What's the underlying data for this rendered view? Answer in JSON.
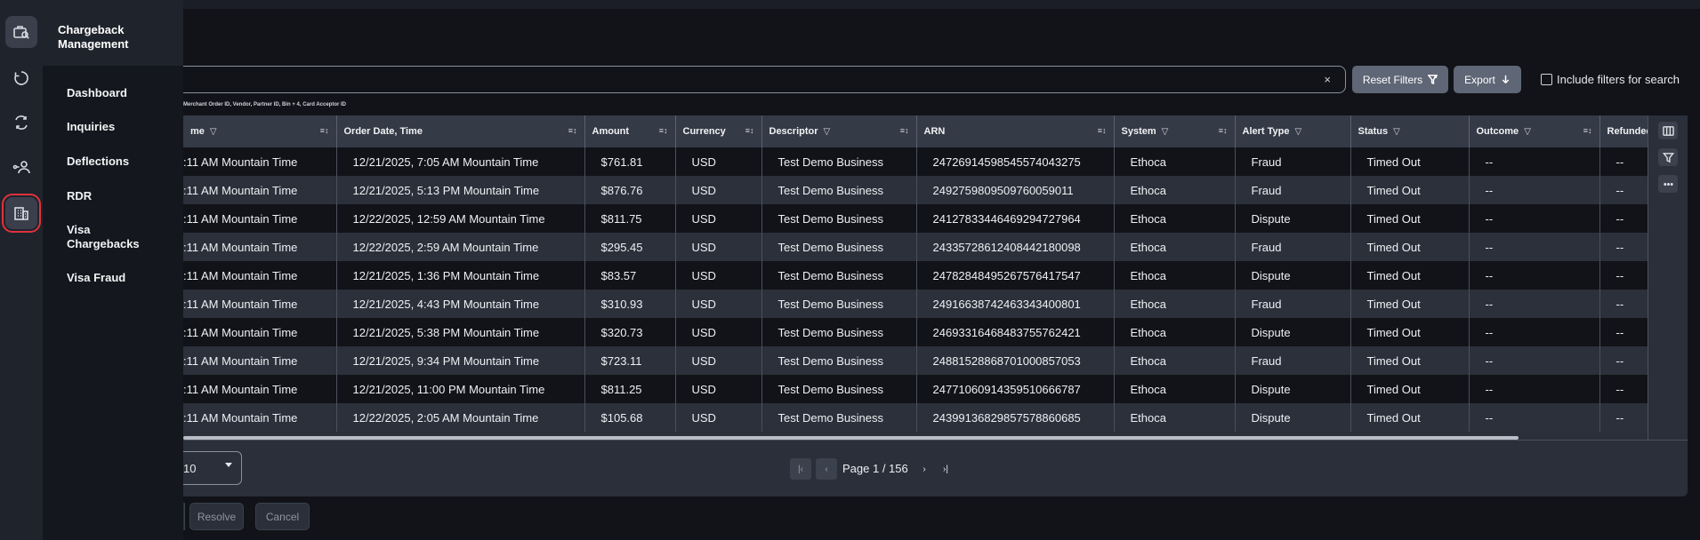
{
  "sidebar": {
    "title_line1": "Chargeback",
    "title_line2": "Management",
    "items": [
      {
        "label": "Dashboard"
      },
      {
        "label": "Inquiries"
      },
      {
        "label": "Deflections"
      },
      {
        "label": "RDR"
      },
      {
        "label": "Visa Chargebacks"
      },
      {
        "label": "Visa Fraud"
      }
    ]
  },
  "search": {
    "clear": "×",
    "hint": "Merchant Order ID, Vendor, Partner ID, Bin + 4, Card Acceptor ID"
  },
  "toolbar": {
    "reset_label": "Reset Filters",
    "export_label": "Export",
    "include_filters_label": "Include filters for search"
  },
  "table": {
    "columns": [
      "me",
      "Order Date, Time",
      "Amount",
      "Currency",
      "Descriptor",
      "ARN",
      "System",
      "Alert Type",
      "Status",
      "Outcome",
      "Refunded"
    ],
    "rows": [
      [
        ":11 AM Mountain Time",
        "12/21/2025, 7:05 AM Mountain Time",
        "$761.81",
        "USD",
        "Test Demo Business",
        "2472691459854557404327​5",
        "Ethoca",
        "Fraud",
        "Timed Out",
        "--",
        "--"
      ],
      [
        ":11 AM Mountain Time",
        "12/21/2025, 5:13 PM Mountain Time",
        "$876.76",
        "USD",
        "Test Demo Business",
        "24927598095097600590​11",
        "Ethoca",
        "Fraud",
        "Timed Out",
        "--",
        "--"
      ],
      [
        ":11 AM Mountain Time",
        "12/22/2025, 12:59 AM Mountain Time",
        "$811.75",
        "USD",
        "Test Demo Business",
        "24127833446469294727964",
        "Ethoca",
        "Dispute",
        "Timed Out",
        "--",
        "--"
      ],
      [
        ":11 AM Mountain Time",
        "12/22/2025, 2:59 AM Mountain Time",
        "$295.45",
        "USD",
        "Test Demo Business",
        "24335728612408442180098",
        "Ethoca",
        "Fraud",
        "Timed Out",
        "--",
        "--"
      ],
      [
        ":11 AM Mountain Time",
        "12/21/2025, 1:36 PM Mountain Time",
        "$83.57",
        "USD",
        "Test Demo Business",
        "24782848495267576417547",
        "Ethoca",
        "Dispute",
        "Timed Out",
        "--",
        "--"
      ],
      [
        ":11 AM Mountain Time",
        "12/21/2025, 4:43 PM Mountain Time",
        "$310.93",
        "USD",
        "Test Demo Business",
        "24916638742463343400801",
        "Ethoca",
        "Fraud",
        "Timed Out",
        "--",
        "--"
      ],
      [
        ":11 AM Mountain Time",
        "12/21/2025, 5:38 PM Mountain Time",
        "$320.73",
        "USD",
        "Test Demo Business",
        "24693316468483755762421",
        "Ethoca",
        "Dispute",
        "Timed Out",
        "--",
        "--"
      ],
      [
        ":11 AM Mountain Time",
        "12/21/2025, 9:34 PM Mountain Time",
        "$723.11",
        "USD",
        "Test Demo Business",
        "24881528868701000857053",
        "Ethoca",
        "Fraud",
        "Timed Out",
        "--",
        "--"
      ],
      [
        ":11 AM Mountain Time",
        "12/21/2025, 11:00 PM Mountain Time",
        "$811.25",
        "USD",
        "Test Demo Business",
        "24771060914359510666787",
        "Ethoca",
        "Dispute",
        "Timed Out",
        "--",
        "--"
      ],
      [
        ":11 AM Mountain Time",
        "12/22/2025, 2:05 AM Mountain Time",
        "$105.68",
        "USD",
        "Test Demo Business",
        "24399136829857578860685",
        "Ethoca",
        "Dispute",
        "Timed Out",
        "--",
        "--"
      ]
    ]
  },
  "pagination": {
    "page_size": "10",
    "page_label": "Page 1 / 156"
  },
  "actions": {
    "resolve_label": "Resolve",
    "cancel_label": "Cancel"
  }
}
